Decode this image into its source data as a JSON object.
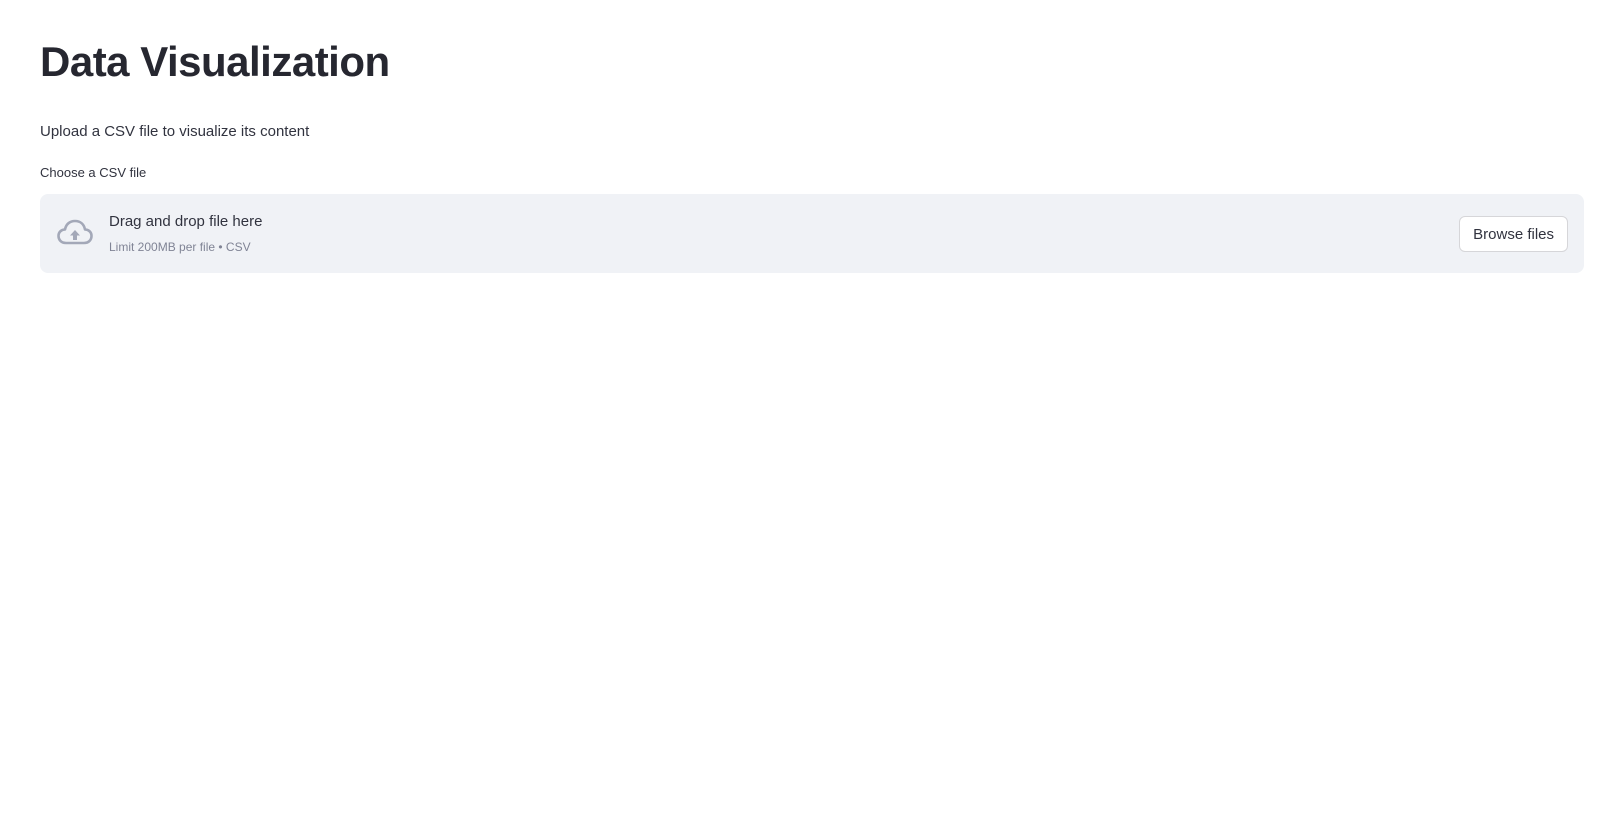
{
  "page": {
    "title": "Data Visualization",
    "subtitle": "Upload a CSV file to visualize its content"
  },
  "uploader": {
    "label": "Choose a CSV file",
    "drop_text": "Drag and drop file here",
    "limit_text": "Limit 200MB per file • CSV",
    "browse_label": "Browse files",
    "icon": "cloud-upload-icon"
  },
  "colors": {
    "dropzone_bg": "#f0f2f6",
    "icon": "#a3a8b8",
    "text": "#31333f",
    "muted_text": "#808495"
  }
}
